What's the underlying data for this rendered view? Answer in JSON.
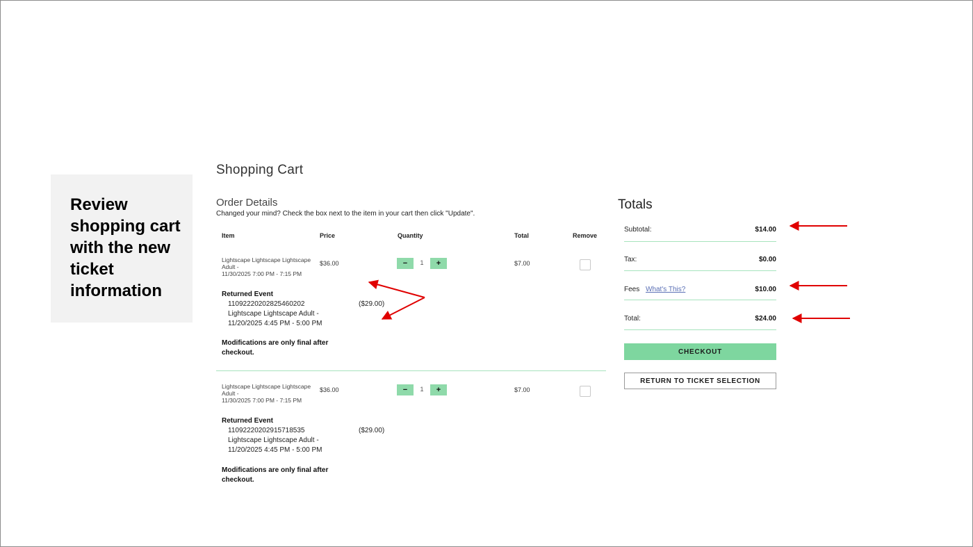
{
  "callout": {
    "text": "Review shopping cart with the new ticket information"
  },
  "cart": {
    "title": "Shopping Cart",
    "order_details_title": "Order Details",
    "hint": "Changed your mind?  Check the box next to the item in your cart then click \"Update\".",
    "columns": {
      "item": "Item",
      "price": "Price",
      "quantity": "Quantity",
      "total": "Total",
      "remove": "Remove"
    },
    "items": [
      {
        "name": "Lightscape Lightscape Lightscape Adult    -",
        "datetime": "11/30/2025 7:00 PM - 7:15 PM",
        "price": "$36.00",
        "quantity": "1",
        "total": "$7.00",
        "returned_title": "Returned Event",
        "returned_id": "11092220202825460202",
        "returned_name": "Lightscape Lightscape Adult   -",
        "returned_datetime": "11/20/2025 4:45 PM - 5:00 PM",
        "returned_credit": "($29.00)",
        "note": "Modifications are only final after checkout."
      },
      {
        "name": "Lightscape Lightscape Lightscape Adult    -",
        "datetime": "11/30/2025 7:00 PM - 7:15 PM",
        "price": "$36.00",
        "quantity": "1",
        "total": "$7.00",
        "returned_title": "Returned Event",
        "returned_id": "11092220202915718535",
        "returned_name": "Lightscape Lightscape Adult   -",
        "returned_datetime": "11/20/2025 4:45 PM - 5:00 PM",
        "returned_credit": "($29.00)",
        "note": "Modifications are only final after checkout."
      }
    ],
    "qty_minus": "−",
    "qty_plus": "+"
  },
  "totals": {
    "title": "Totals",
    "subtotal_label": "Subtotal:",
    "subtotal_value": "$14.00",
    "tax_label": "Tax:",
    "tax_value": "$0.00",
    "fees_label": "Fees",
    "fees_link": "What's This?",
    "fees_value": "$10.00",
    "total_label": "Total:",
    "total_value": "$24.00",
    "checkout_label": "CHECKOUT",
    "return_label": "RETURN TO TICKET SELECTION"
  },
  "colors": {
    "accent_green": "#7ed69f",
    "divider_green": "#a6e3bd",
    "annotation_red": "#e00000"
  }
}
